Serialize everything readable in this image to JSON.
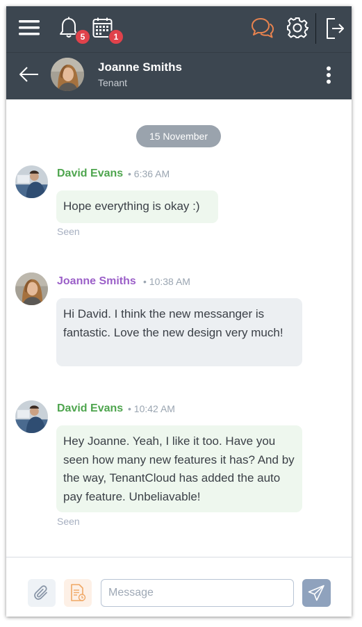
{
  "header": {
    "notifications_count": "5",
    "calendar_count": "1",
    "contact_name": "Joanne Smiths",
    "contact_role": "Tenant",
    "icons": [
      "menu-icon",
      "bell-icon",
      "calendar-icon",
      "chat-icon",
      "gear-icon",
      "logout-icon",
      "back-arrow-icon",
      "more-vertical-icon"
    ]
  },
  "chat": {
    "date_divider": "15 November",
    "messages": [
      {
        "sender": "David Evans",
        "time": "• 6:36 AM",
        "text": "Hope everything is okay :)",
        "status": "Seen"
      },
      {
        "sender": "Joanne Smiths",
        "time": "• 10:38 AM",
        "text": "Hi David. I think the new messanger is fantastic. Love the new design very much!"
      },
      {
        "sender": "David Evans",
        "time": "• 10:42 AM",
        "text": "Hey Joanne. Yeah, I like it too. Have you seen how many new features it has? And by the way, TenantCloud has added the auto pay feature. Unbeliavable!",
        "status": "Seen"
      }
    ]
  },
  "composer": {
    "placeholder": "Message",
    "icons": [
      "paperclip-icon",
      "document-icon",
      "send-icon"
    ]
  },
  "colors": {
    "header_bg": "#3c4650",
    "badge": "#e0424b",
    "chat_icon_accent": "#e8834f",
    "david_name": "#4ea54e",
    "joanne_name": "#9b5fc8",
    "bubble_in": "#eef7ee",
    "bubble_out": "#eceff2",
    "send_button": "#8fa2bd"
  }
}
